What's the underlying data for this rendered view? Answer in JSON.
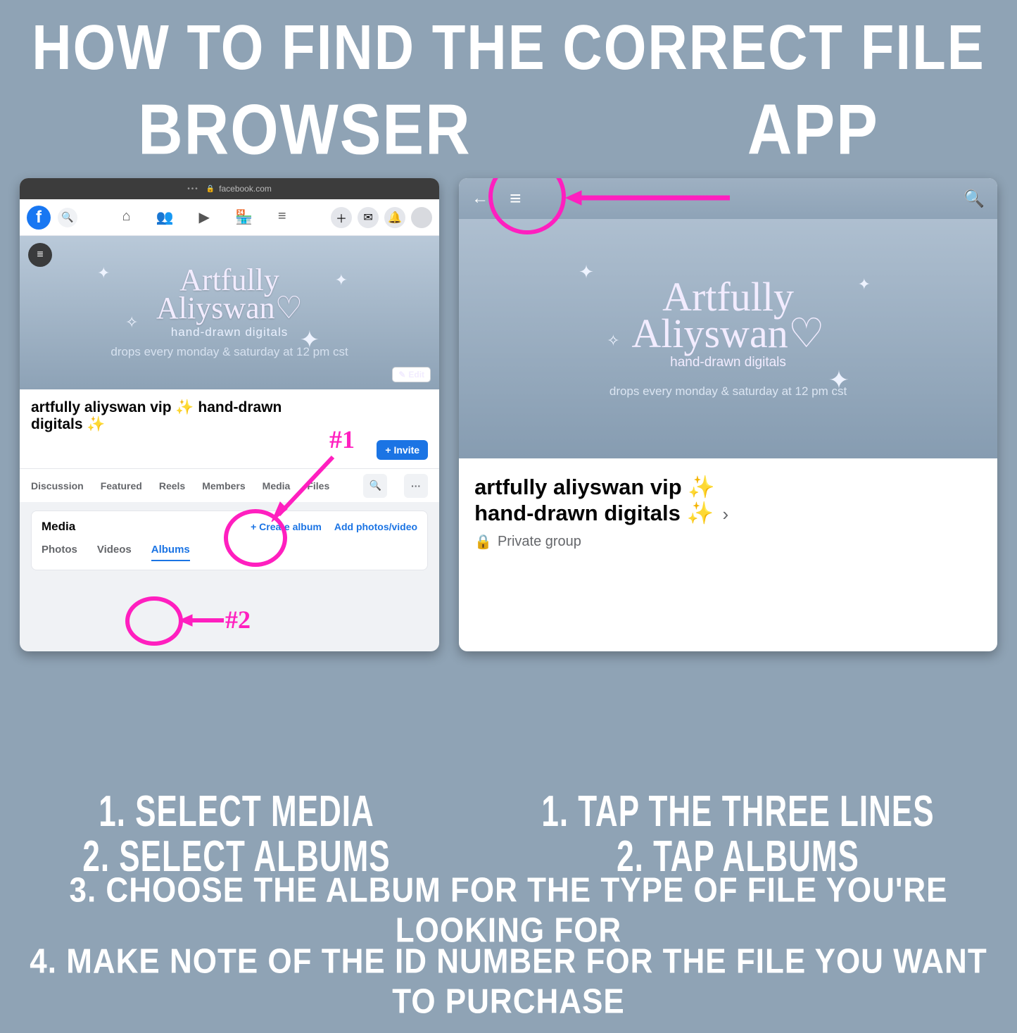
{
  "title": "HOW TO FIND THE CORRECT FILE",
  "browser_label": "BROWSER",
  "app_label": "APP",
  "address_bar": {
    "host": "facebook.com"
  },
  "cover": {
    "brand_line1": "Artfully",
    "brand_line2": "Aliyswan♡",
    "subtitle": "hand-drawn digitals",
    "drops": "drops every monday & saturday at 12 pm cst",
    "edit_label": "Edit"
  },
  "group": {
    "name": "artfully aliyswan vip ✨ hand-drawn digitals ✨",
    "invite_label": "+ Invite",
    "privacy": "Private group"
  },
  "tabs": {
    "discussion": "Discussion",
    "featured": "Featured",
    "reels": "Reels",
    "members": "Members",
    "media": "Media",
    "files": "Files"
  },
  "media_card": {
    "title": "Media",
    "create_album": "+  Create album",
    "add_photos": "Add photos/video",
    "sub_photos": "Photos",
    "sub_videos": "Videos",
    "sub_albums": "Albums"
  },
  "annotations": {
    "num1": "#1",
    "num2": "#2"
  },
  "app_group": {
    "line1": "artfully aliyswan vip ✨",
    "line2": "hand-drawn digitals ✨"
  },
  "instructions": {
    "browser": [
      "1. SELECT MEDIA",
      "2. SELECT ALBUMS"
    ],
    "app": [
      "1. TAP THE THREE LINES",
      "2. TAP ALBUMS"
    ],
    "full": [
      "3. CHOOSE THE ALBUM FOR THE TYPE OF FILE YOU'RE LOOKING FOR",
      "4. MAKE NOTE OF THE ID NUMBER FOR THE FILE YOU WANT TO PURCHASE"
    ]
  }
}
